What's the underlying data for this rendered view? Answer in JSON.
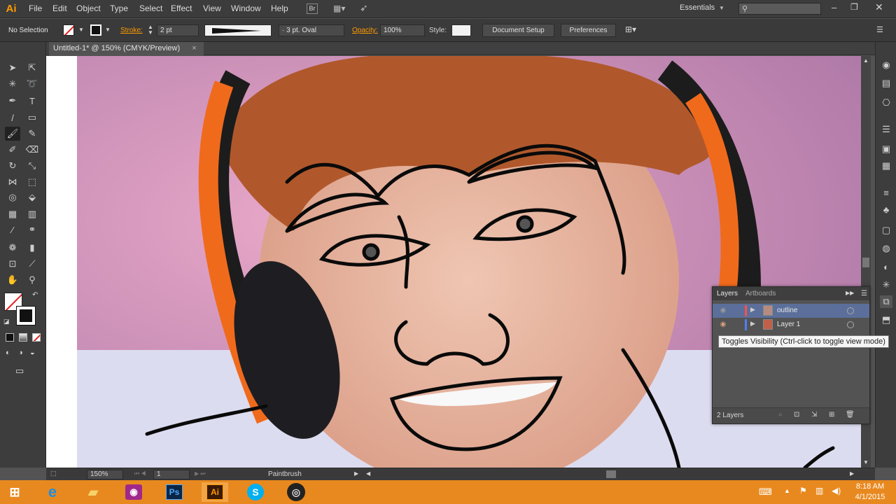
{
  "app": {
    "logo": "Ai",
    "workspace": "Essentials",
    "search_placeholder": ""
  },
  "menu": [
    "File",
    "Edit",
    "Object",
    "Type",
    "Select",
    "Effect",
    "View",
    "Window",
    "Help"
  ],
  "control": {
    "selection": "No Selection",
    "stroke_label": "Stroke:",
    "stroke_value": "2 pt",
    "brush_value": "3 pt. Oval",
    "opacity_label": "Opacity:",
    "opacity_value": "100%",
    "style_label": "Style:",
    "document_setup": "Document Setup",
    "preferences": "Preferences"
  },
  "document": {
    "tab_title": "Untitled-1* @ 150% (CMYK/Preview)",
    "close": "×"
  },
  "status": {
    "zoom": "150%",
    "page": "1",
    "tool": "Paintbrush"
  },
  "layers_panel": {
    "tabs": [
      "Layers",
      "Artboards"
    ],
    "rows": [
      {
        "name": "outline",
        "color": "#ff4f4f",
        "selected": true
      },
      {
        "name": "Layer 1",
        "color": "#4f7fff",
        "selected": false
      }
    ],
    "count": "2 Layers",
    "tooltip": "Toggles Visibility (Ctrl-click to toggle view mode)"
  },
  "taskbar": {
    "apps": [
      "start-icon",
      "internet-explorer-icon",
      "file-explorer-icon",
      "camera-app-icon",
      "photoshop-icon",
      "illustrator-icon",
      "skype-icon",
      "obs-icon"
    ],
    "ps_label": "Ps",
    "ai_label": "Ai",
    "time": "8:18 AM",
    "date": "4/1/2015"
  },
  "colors": {
    "accent": "#ff9a00",
    "taskbar": "#e8891f",
    "ui_dark": "#3c3c3c"
  }
}
